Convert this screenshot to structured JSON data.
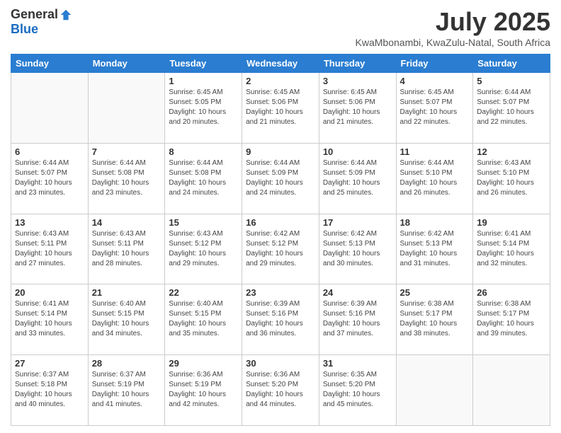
{
  "logo": {
    "general": "General",
    "blue": "Blue"
  },
  "title": "July 2025",
  "subtitle": "KwaMbonambi, KwaZulu-Natal, South Africa",
  "days_of_week": [
    "Sunday",
    "Monday",
    "Tuesday",
    "Wednesday",
    "Thursday",
    "Friday",
    "Saturday"
  ],
  "weeks": [
    [
      {
        "day": "",
        "info": ""
      },
      {
        "day": "",
        "info": ""
      },
      {
        "day": "1",
        "info": "Sunrise: 6:45 AM\nSunset: 5:05 PM\nDaylight: 10 hours and 20 minutes."
      },
      {
        "day": "2",
        "info": "Sunrise: 6:45 AM\nSunset: 5:06 PM\nDaylight: 10 hours and 21 minutes."
      },
      {
        "day": "3",
        "info": "Sunrise: 6:45 AM\nSunset: 5:06 PM\nDaylight: 10 hours and 21 minutes."
      },
      {
        "day": "4",
        "info": "Sunrise: 6:45 AM\nSunset: 5:07 PM\nDaylight: 10 hours and 22 minutes."
      },
      {
        "day": "5",
        "info": "Sunrise: 6:44 AM\nSunset: 5:07 PM\nDaylight: 10 hours and 22 minutes."
      }
    ],
    [
      {
        "day": "6",
        "info": "Sunrise: 6:44 AM\nSunset: 5:07 PM\nDaylight: 10 hours and 23 minutes."
      },
      {
        "day": "7",
        "info": "Sunrise: 6:44 AM\nSunset: 5:08 PM\nDaylight: 10 hours and 23 minutes."
      },
      {
        "day": "8",
        "info": "Sunrise: 6:44 AM\nSunset: 5:08 PM\nDaylight: 10 hours and 24 minutes."
      },
      {
        "day": "9",
        "info": "Sunrise: 6:44 AM\nSunset: 5:09 PM\nDaylight: 10 hours and 24 minutes."
      },
      {
        "day": "10",
        "info": "Sunrise: 6:44 AM\nSunset: 5:09 PM\nDaylight: 10 hours and 25 minutes."
      },
      {
        "day": "11",
        "info": "Sunrise: 6:44 AM\nSunset: 5:10 PM\nDaylight: 10 hours and 26 minutes."
      },
      {
        "day": "12",
        "info": "Sunrise: 6:43 AM\nSunset: 5:10 PM\nDaylight: 10 hours and 26 minutes."
      }
    ],
    [
      {
        "day": "13",
        "info": "Sunrise: 6:43 AM\nSunset: 5:11 PM\nDaylight: 10 hours and 27 minutes."
      },
      {
        "day": "14",
        "info": "Sunrise: 6:43 AM\nSunset: 5:11 PM\nDaylight: 10 hours and 28 minutes."
      },
      {
        "day": "15",
        "info": "Sunrise: 6:43 AM\nSunset: 5:12 PM\nDaylight: 10 hours and 29 minutes."
      },
      {
        "day": "16",
        "info": "Sunrise: 6:42 AM\nSunset: 5:12 PM\nDaylight: 10 hours and 29 minutes."
      },
      {
        "day": "17",
        "info": "Sunrise: 6:42 AM\nSunset: 5:13 PM\nDaylight: 10 hours and 30 minutes."
      },
      {
        "day": "18",
        "info": "Sunrise: 6:42 AM\nSunset: 5:13 PM\nDaylight: 10 hours and 31 minutes."
      },
      {
        "day": "19",
        "info": "Sunrise: 6:41 AM\nSunset: 5:14 PM\nDaylight: 10 hours and 32 minutes."
      }
    ],
    [
      {
        "day": "20",
        "info": "Sunrise: 6:41 AM\nSunset: 5:14 PM\nDaylight: 10 hours and 33 minutes."
      },
      {
        "day": "21",
        "info": "Sunrise: 6:40 AM\nSunset: 5:15 PM\nDaylight: 10 hours and 34 minutes."
      },
      {
        "day": "22",
        "info": "Sunrise: 6:40 AM\nSunset: 5:15 PM\nDaylight: 10 hours and 35 minutes."
      },
      {
        "day": "23",
        "info": "Sunrise: 6:39 AM\nSunset: 5:16 PM\nDaylight: 10 hours and 36 minutes."
      },
      {
        "day": "24",
        "info": "Sunrise: 6:39 AM\nSunset: 5:16 PM\nDaylight: 10 hours and 37 minutes."
      },
      {
        "day": "25",
        "info": "Sunrise: 6:38 AM\nSunset: 5:17 PM\nDaylight: 10 hours and 38 minutes."
      },
      {
        "day": "26",
        "info": "Sunrise: 6:38 AM\nSunset: 5:17 PM\nDaylight: 10 hours and 39 minutes."
      }
    ],
    [
      {
        "day": "27",
        "info": "Sunrise: 6:37 AM\nSunset: 5:18 PM\nDaylight: 10 hours and 40 minutes."
      },
      {
        "day": "28",
        "info": "Sunrise: 6:37 AM\nSunset: 5:19 PM\nDaylight: 10 hours and 41 minutes."
      },
      {
        "day": "29",
        "info": "Sunrise: 6:36 AM\nSunset: 5:19 PM\nDaylight: 10 hours and 42 minutes."
      },
      {
        "day": "30",
        "info": "Sunrise: 6:36 AM\nSunset: 5:20 PM\nDaylight: 10 hours and 44 minutes."
      },
      {
        "day": "31",
        "info": "Sunrise: 6:35 AM\nSunset: 5:20 PM\nDaylight: 10 hours and 45 minutes."
      },
      {
        "day": "",
        "info": ""
      },
      {
        "day": "",
        "info": ""
      }
    ]
  ]
}
